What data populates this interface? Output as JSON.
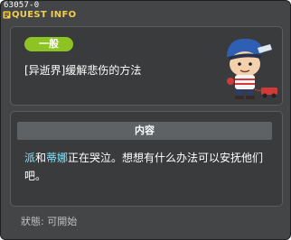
{
  "window_id": "63057-0",
  "title": "QUEST INFO",
  "quest": {
    "badge": "一般",
    "name": "[异逝界]缓解悲伤的方法"
  },
  "content": {
    "header": "内容",
    "desc_name1": "派",
    "desc_and": "和",
    "desc_name2": "蒂娜",
    "desc_rest": "正在哭泣。想想有什么办法可以安抚他们吧。"
  },
  "status": {
    "label": "狀態:",
    "value": "可開始"
  },
  "colors": {
    "title": "#f2ce4f",
    "badge": "#8dc322",
    "highlight": "#7fe6ff"
  },
  "icons": [
    "quest-title-icon",
    "npc-character-icon"
  ]
}
